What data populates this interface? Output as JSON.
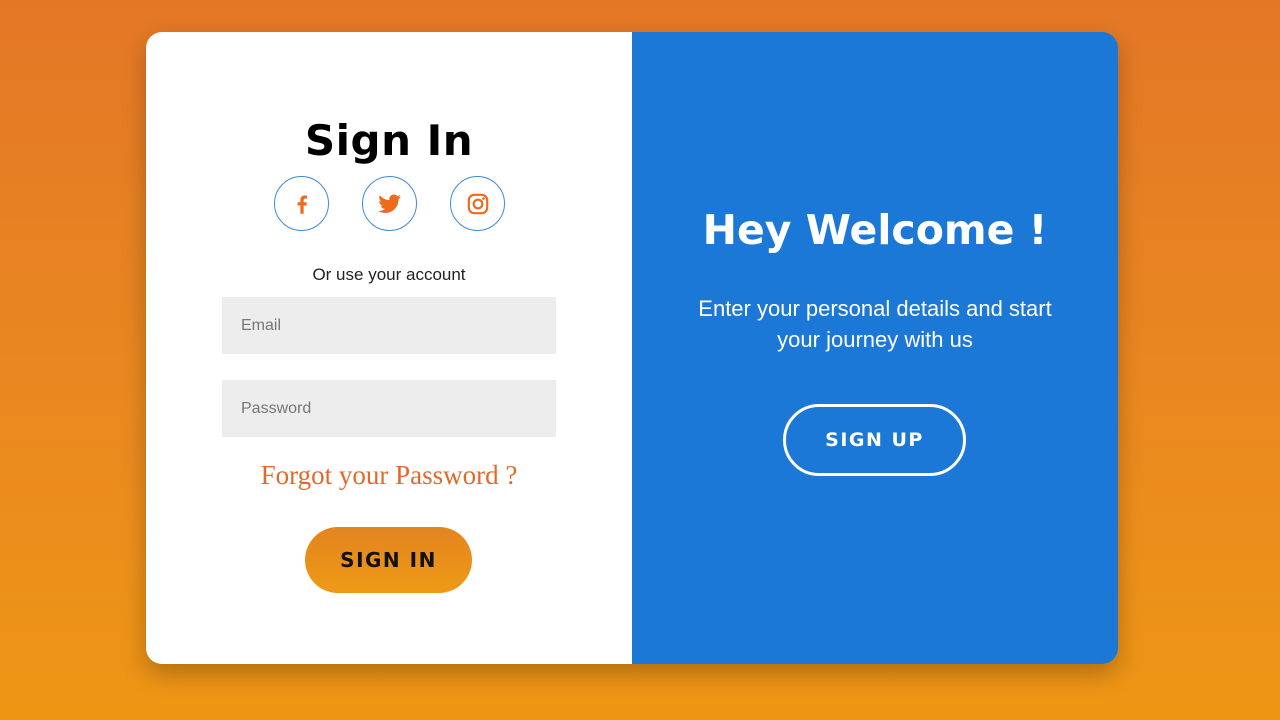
{
  "colors": {
    "background_top": "#e47726",
    "background_bottom": "#ee9614",
    "accent_blue": "#1c78d6",
    "accent_orange": "#e2692a",
    "icon_orange": "#ec6b1c"
  },
  "signin": {
    "title": "Sign In",
    "socials": [
      {
        "icon": "facebook-icon"
      },
      {
        "icon": "twitter-icon"
      },
      {
        "icon": "instagram-icon"
      }
    ],
    "alt_text": "Or use your account",
    "email_placeholder": "Email",
    "password_placeholder": "Password",
    "forgot_label": "Forgot your Password ?",
    "button_label": "SIGN IN"
  },
  "welcome": {
    "title": "Hey Welcome !",
    "subtitle": "Enter your personal details and start your journey with us",
    "button_label": "SIGN UP"
  }
}
